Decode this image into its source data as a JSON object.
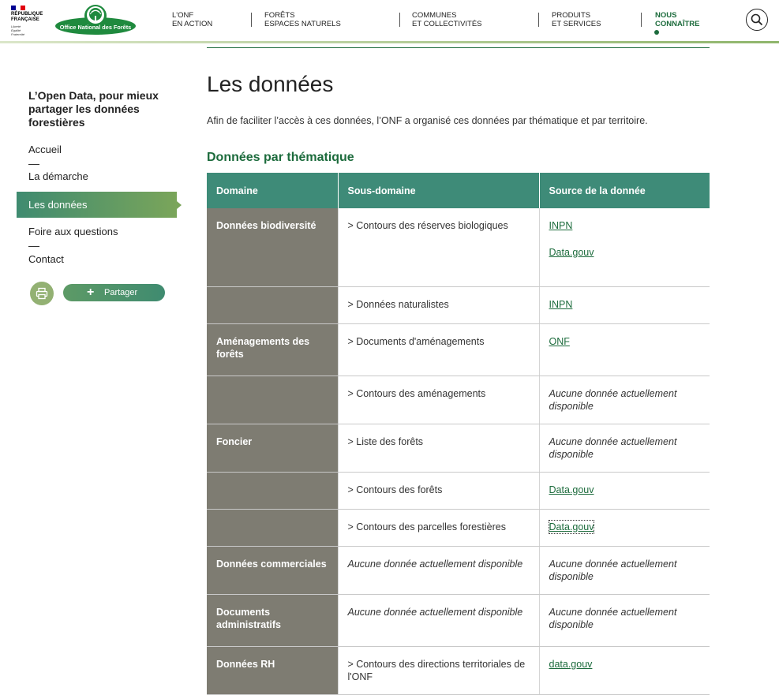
{
  "header": {
    "rf_title": [
      "RÉPUBLIQUE",
      "FRANÇAISE"
    ],
    "rf_motto": [
      "Liberté",
      "Égalité",
      "Fraternité"
    ],
    "logo_text": "Office National des Forêts",
    "nav": [
      {
        "line1": "L'ONF",
        "line2": "EN ACTION"
      },
      {
        "line1": "FORÊTS",
        "line2": "ESPACES NATURELS"
      },
      {
        "line1": "COMMUNES",
        "line2": "ET COLLECTIVITÉS"
      },
      {
        "line1": "PRODUITS",
        "line2": "ET SERVICES"
      },
      {
        "line1": "NOUS",
        "line2": "CONNAÎTRE"
      }
    ],
    "accent": "#1c6b3c"
  },
  "sidebar": {
    "title": "L’Open Data, pour mieux partager les données forestières",
    "items": [
      "Accueil",
      "La démarche",
      "Les données",
      "Foire aux questions",
      "Contact"
    ],
    "share_label": "Partager"
  },
  "main": {
    "title": "Les données",
    "intro": "Afin de faciliter l’accès à ces données, l’ONF a organisé ces données par thématique et par territoire.",
    "section_title": "Données par thématique",
    "table": {
      "headers": [
        "Domaine",
        "Sous-domaine",
        "Source de la donnée"
      ],
      "rows": [
        {
          "domain": "Données biodiversité",
          "sub": "> Contours des réserves biologiques",
          "sources": [
            "INPN",
            "Data.gouv"
          ]
        },
        {
          "domain": "",
          "sub": "> Données naturalistes",
          "sources": [
            "INPN"
          ]
        },
        {
          "domain": "Aménagements des forêts",
          "sub": "> Documents d'aménagements",
          "sources": [
            "ONF"
          ]
        },
        {
          "domain": "",
          "sub": "> Contours des aménagements",
          "none": "Aucune donnée actuellement disponible"
        },
        {
          "domain": "Foncier",
          "sub": "> Liste des forêts",
          "none": "Aucune donnée actuellement disponible"
        },
        {
          "domain": "",
          "sub": "> Contours des forêts",
          "sources": [
            "Data.gouv"
          ]
        },
        {
          "domain": "",
          "sub": "> Contours des parcelles forestières",
          "sources": [
            "Data.gouv"
          ]
        },
        {
          "domain": "Données commerciales",
          "sub_none": "Aucune donnée actuellement disponible",
          "none": "Aucune donnée actuellement disponible"
        },
        {
          "domain": "Documents administratifs",
          "sub_none": "Aucune donnée actuellement disponible",
          "none": "Aucune donnée actuellement disponible"
        },
        {
          "domain": "Données RH",
          "sub": "> Contours des directions territoriales de l'ONF",
          "sources": [
            "data.gouv"
          ]
        }
      ]
    }
  }
}
